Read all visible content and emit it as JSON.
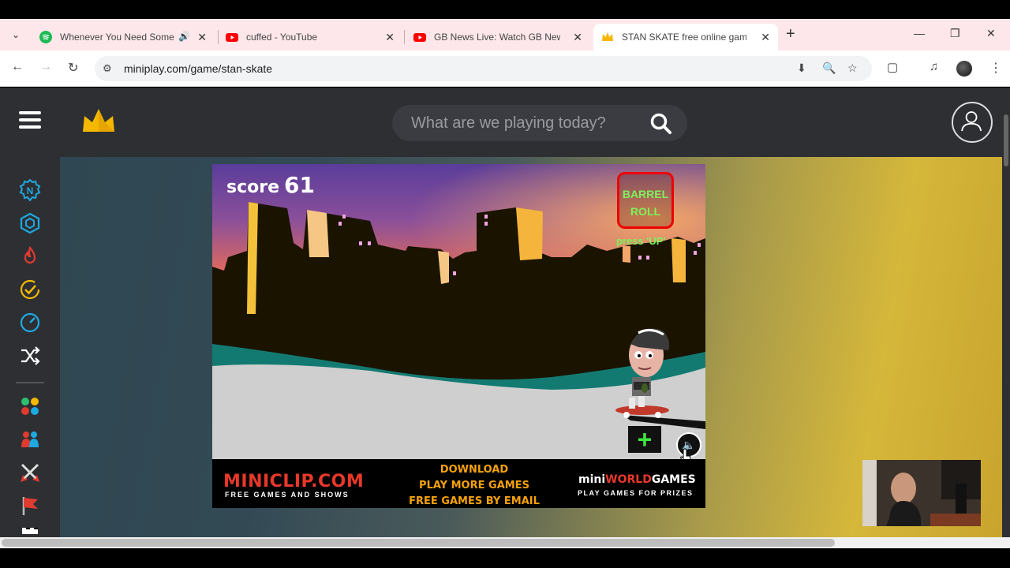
{
  "browser": {
    "tabs": [
      {
        "title": "Whenever You Need Somebody",
        "favicon": "spotify-icon",
        "audio": true
      },
      {
        "title": "cuffed - YouTube",
        "favicon": "youtube-icon"
      },
      {
        "title": "GB News Live: Watch GB News",
        "favicon": "youtube-icon"
      },
      {
        "title": "STAN SKATE free online game on",
        "favicon": "crown-icon",
        "active": true
      }
    ],
    "url": "miniplay.com/game/stan-skate"
  },
  "site": {
    "search_placeholder": "What are we playing today?"
  },
  "game": {
    "score_label": "score",
    "score_value": "61",
    "trick_name_line1": "BARREL",
    "trick_name_line2": "ROLL",
    "trick_hint": "press 'UP'",
    "footer": {
      "miniclip": "MINICLIP.COM",
      "miniclip_sub": "FREE GAMES AND SHOWS",
      "download": "DOWNLOAD",
      "play_more": "PLAY MORE GAMES",
      "email": "FREE GAMES BY EMAIL",
      "mwg_prefix": "mini",
      "mwg_mid": "WORLD",
      "mwg_suffix": "GAMES",
      "mwg_sub": "PLAY GAMES FOR PRIZES"
    }
  },
  "colors": {
    "site_header": "#2d2f33",
    "accent_yellow": "#f5b800",
    "trick_green": "#7df25c",
    "trick_border": "#e00000"
  }
}
